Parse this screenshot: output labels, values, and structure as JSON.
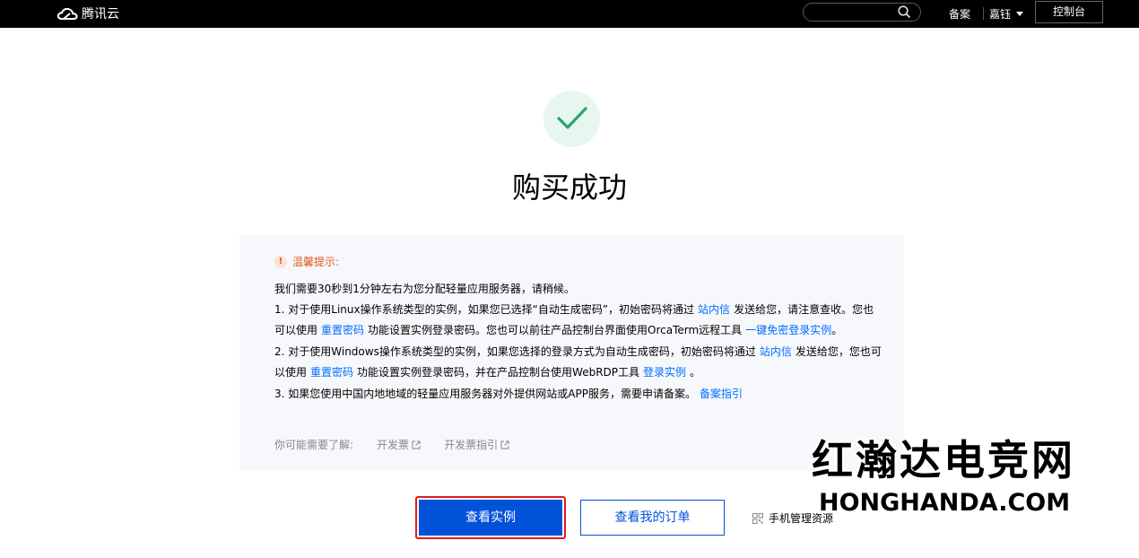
{
  "header": {
    "logo_text": "腾讯云",
    "search_placeholder": "",
    "beian": "备案",
    "user": "嘉钰",
    "console": "控制台"
  },
  "result": {
    "title": "购买成功"
  },
  "notice": {
    "label": "温馨提示:",
    "line1": "我们需要30秒到1分钟左右为您分配轻量应用服务器，请稍候。",
    "item1": {
      "a": "1. 对于使用Linux操作系统类型的实例，如果您已选择“自动生成密码”，初始密码将通过",
      "link1": "站内信",
      "b": "发送给您，请注意查收。您也",
      "c": "可以使用",
      "link2": "重置密码",
      "d": "功能设置实例登录密码。您也可以前往产品控制台界面使用OrcaTerm远程工具",
      "link3": "一键免密登录实例",
      "e": "。"
    },
    "item2": {
      "a": "2. 对于使用Windows操作系统类型的实例，如果您选择的登录方式为自动生成密码，初始密码将通过",
      "link1": "站内信",
      "b": "发送给您，您也可",
      "c": "以使用",
      "link2": "重置密码",
      "d": "功能设置实例登录密码，并在产品控制台使用WebRDP工具",
      "link3": "登录实例",
      "e": "。"
    },
    "item3": {
      "a": "3. 如果您使用中国内地地域的轻量应用服务器对外提供网站或APP服务，需要申请备案。",
      "link1": "备案指引"
    },
    "more": {
      "label": "你可能需要了解:",
      "link1": "开发票",
      "link2": "开发票指引"
    }
  },
  "actions": {
    "primary": "查看实例",
    "secondary": "查看我的订单",
    "mobile": "手机管理资源"
  },
  "watermark": {
    "cn": "红瀚达电竞网",
    "en": "HONGHANDA.COM"
  },
  "colors": {
    "accent": "#0052d9",
    "link": "#006eff",
    "warning": "#e35b1f",
    "success": "#2ba471"
  }
}
